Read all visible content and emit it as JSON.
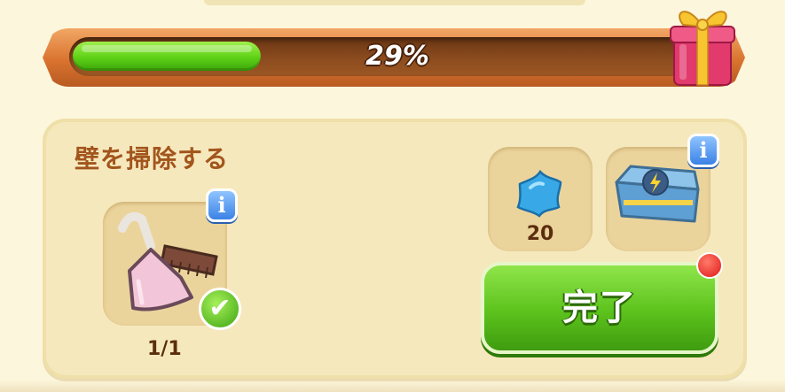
{
  "progress": {
    "percent_label": "29%",
    "fraction": 0.29,
    "reward_icon": "gift-box-icon"
  },
  "task": {
    "title": "壁を掃除する",
    "item": {
      "icon": "dustpan-brush-icon",
      "count": "1/1",
      "completed": true
    },
    "rewards": [
      {
        "icon": "blue-star-gem-icon",
        "amount": "20"
      },
      {
        "icon": "lightning-chest-icon",
        "has_info": true
      }
    ],
    "done_button_label": "完了"
  },
  "colors": {
    "progress_green": "#5ed116",
    "frame_orange": "#d9732f",
    "title_brown": "#a2551c",
    "alert_red": "#e01818"
  }
}
